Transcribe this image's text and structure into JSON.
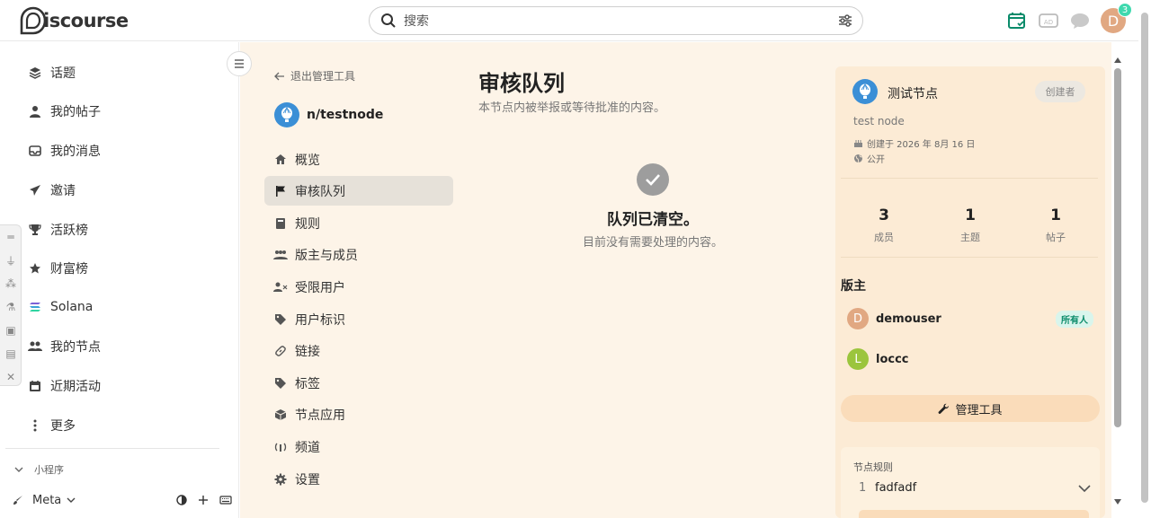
{
  "header": {
    "logo_text": "iscourse",
    "search_placeholder": "搜索",
    "notification_count": "3",
    "user_initial": "D"
  },
  "sidebar": {
    "items": [
      {
        "label": "话题",
        "icon": "layers-icon"
      },
      {
        "label": "我的帖子",
        "icon": "user-icon"
      },
      {
        "label": "我的消息",
        "icon": "inbox-icon"
      },
      {
        "label": "邀请",
        "icon": "paper-plane-icon"
      },
      {
        "label": "活跃榜",
        "icon": "trophy-icon"
      },
      {
        "label": "财富榜",
        "icon": "star-icon"
      },
      {
        "label": "Solana",
        "icon": "solana-icon"
      },
      {
        "label": "我的节点",
        "icon": "users-icon"
      },
      {
        "label": "近期活动",
        "icon": "calendar-icon"
      },
      {
        "label": "更多",
        "icon": "ellipsis-icon"
      }
    ],
    "section_title": "小程序",
    "meta_label": "Meta"
  },
  "admin_nav": {
    "back_label": "退出管理工具",
    "node_name": "n/testnode",
    "items": [
      {
        "label": "概览",
        "icon": "home-icon"
      },
      {
        "label": "审核队列",
        "icon": "flag-icon",
        "active": true
      },
      {
        "label": "规则",
        "icon": "book-icon"
      },
      {
        "label": "版主与成员",
        "icon": "users-icon"
      },
      {
        "label": "受限用户",
        "icon": "user-x-icon"
      },
      {
        "label": "用户标识",
        "icon": "tags-icon"
      },
      {
        "label": "链接",
        "icon": "link-icon"
      },
      {
        "label": "标签",
        "icon": "tag-icon"
      },
      {
        "label": "节点应用",
        "icon": "cube-icon"
      },
      {
        "label": "频道",
        "icon": "broadcast-icon"
      },
      {
        "label": "设置",
        "icon": "gear-icon"
      }
    ]
  },
  "content": {
    "title": "审核队列",
    "subtitle": "本节点内被举报或等待批准的内容。",
    "empty_title": "队列已清空。",
    "empty_subtitle": "目前没有需要处理的内容。"
  },
  "node_card": {
    "name": "测试节点",
    "badge": "创建者",
    "description": "test node",
    "created": "创建于 2026 年 8月 16 日",
    "visibility": "公开",
    "stats": [
      {
        "value": "3",
        "label": "成员"
      },
      {
        "value": "1",
        "label": "主题"
      },
      {
        "value": "1",
        "label": "帖子"
      }
    ],
    "moderators_title": "版主",
    "moderators": [
      {
        "initial": "D",
        "name": "demouser",
        "badge": "所有人",
        "color": "#e1a882"
      },
      {
        "initial": "L",
        "name": "loccc",
        "badge": "",
        "color": "#9bc53d"
      }
    ],
    "admin_button": "管理工具",
    "rules_title": "节点规则",
    "rules": [
      {
        "index": "1",
        "text": "fadfadf"
      }
    ]
  },
  "colors": {
    "main_bg": "#fdf4e8",
    "card_bg": "#fcebd5",
    "accent": "#0a8b6a",
    "node_avatar": "#3b8fd6"
  }
}
